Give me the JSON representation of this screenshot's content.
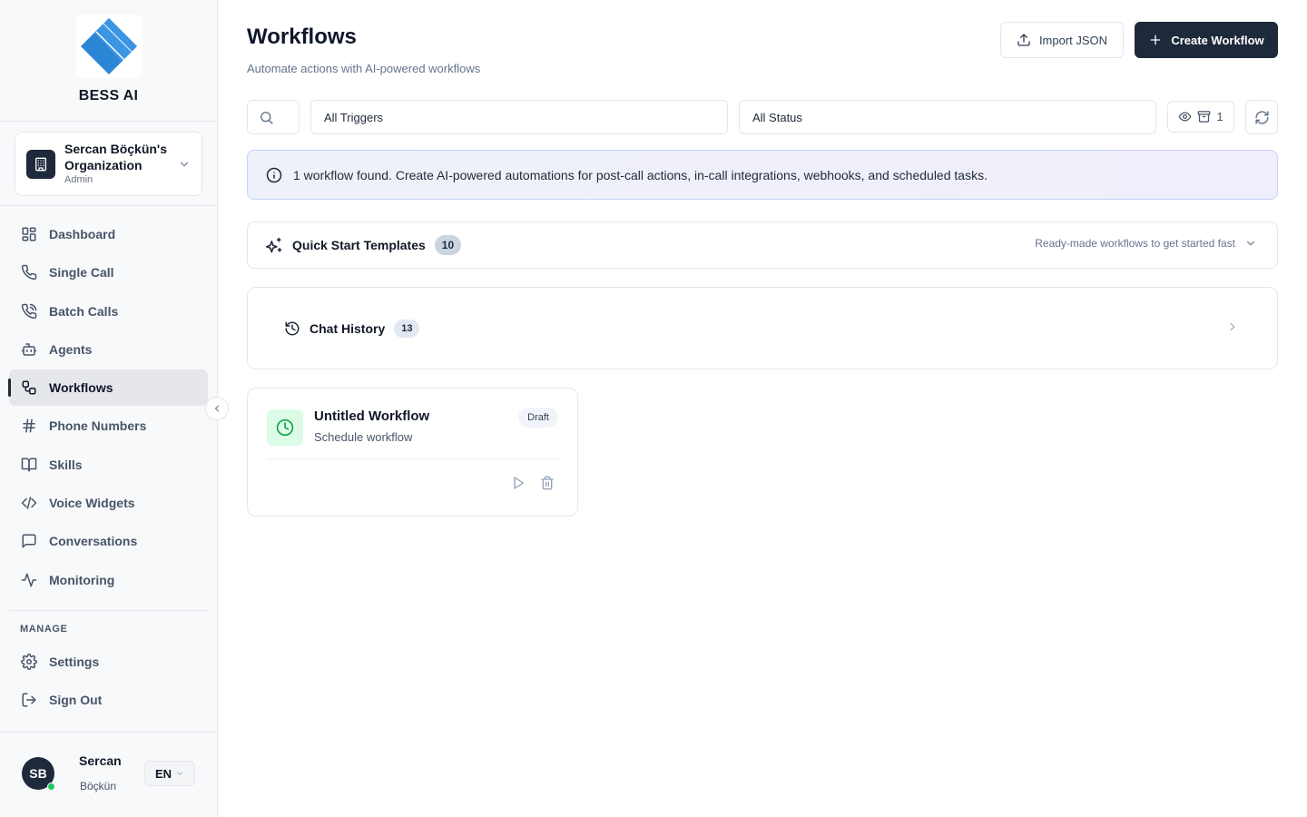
{
  "brand": {
    "name": "BESS AI"
  },
  "org": {
    "name": "Sercan Böçkün's Organization",
    "role": "Admin"
  },
  "nav": {
    "items": [
      {
        "label": "Dashboard",
        "icon": "dashboard-icon"
      },
      {
        "label": "Single Call",
        "icon": "phone-icon"
      },
      {
        "label": "Batch Calls",
        "icon": "phone-calling-icon"
      },
      {
        "label": "Agents",
        "icon": "bot-icon"
      },
      {
        "label": "Workflows",
        "icon": "workflow-icon",
        "active": true
      },
      {
        "label": "Phone Numbers",
        "icon": "hash-icon"
      },
      {
        "label": "Skills",
        "icon": "book-icon"
      },
      {
        "label": "Voice Widgets",
        "icon": "code-icon"
      },
      {
        "label": "Conversations",
        "icon": "message-icon"
      },
      {
        "label": "Monitoring",
        "icon": "activity-icon"
      }
    ],
    "manage_title": "MANAGE",
    "manage_items": [
      {
        "label": "Settings",
        "icon": "gear-icon"
      },
      {
        "label": "Sign Out",
        "icon": "sign-out-icon"
      }
    ]
  },
  "user": {
    "initials": "SB",
    "first_name": "Sercan",
    "last_name": "Böçkün",
    "language": "EN"
  },
  "header": {
    "title": "Workflows",
    "subtitle": "Automate actions with AI-powered workflows",
    "import_label": "Import JSON",
    "create_label": "Create Workflow"
  },
  "filters": {
    "trigger_value": "All Triggers",
    "status_value": "All Status",
    "archived_count": "1"
  },
  "banner": {
    "text": "1 workflow found. Create AI-powered automations for post-call actions, in-call integrations, webhooks, and scheduled tasks."
  },
  "templates": {
    "title": "Quick Start Templates",
    "count": "10",
    "hint": "Ready-made workflows to get started fast"
  },
  "chat_history": {
    "title": "Chat History",
    "count": "13"
  },
  "workflows": [
    {
      "title": "Untitled Workflow",
      "subtitle": "Schedule workflow",
      "status": "Draft"
    }
  ],
  "colors": {
    "primary": "#1e293b",
    "accent_green": "#16a34a",
    "online": "#22c55e"
  }
}
